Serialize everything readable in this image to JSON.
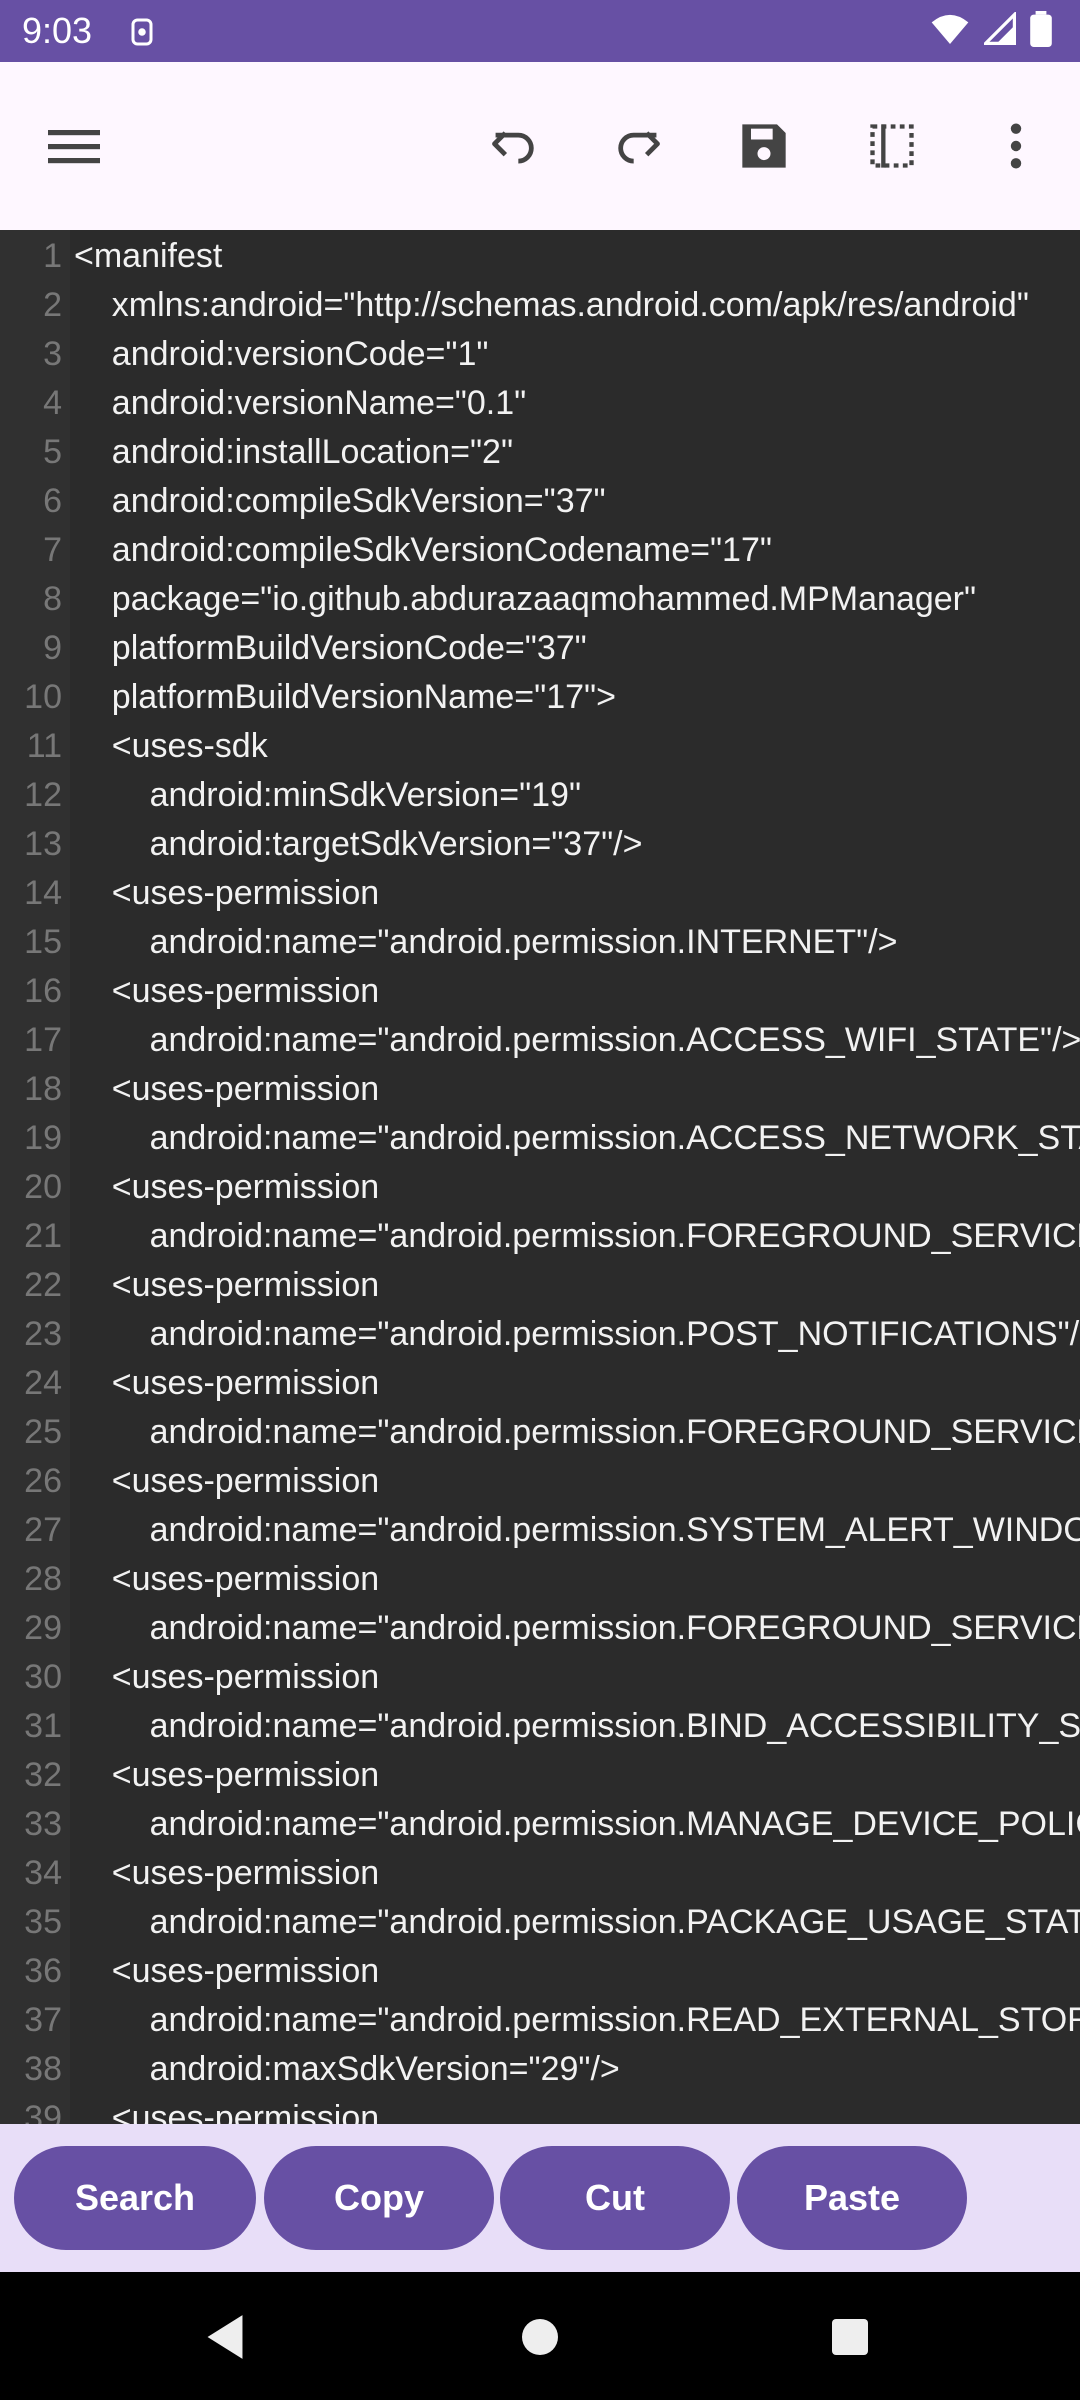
{
  "status": {
    "time": "9:03"
  },
  "toolbar": {
    "menu_icon": "menu-icon",
    "undo_icon": "undo-icon",
    "redo_icon": "redo-icon",
    "save_icon": "save-icon",
    "select_icon": "select-all-icon",
    "more_icon": "more-vert-icon"
  },
  "editor": {
    "lines": [
      {
        "n": "1",
        "text": "<manifest"
      },
      {
        "n": "2",
        "text": "    xmlns:android=\"http://schemas.android.com/apk/res/android\""
      },
      {
        "n": "3",
        "text": "    android:versionCode=\"1\""
      },
      {
        "n": "4",
        "text": "    android:versionName=\"0.1\""
      },
      {
        "n": "5",
        "text": "    android:installLocation=\"2\""
      },
      {
        "n": "6",
        "text": "    android:compileSdkVersion=\"37\""
      },
      {
        "n": "7",
        "text": "    android:compileSdkVersionCodename=\"17\""
      },
      {
        "n": "8",
        "text": "    package=\"io.github.abdurazaaqmohammed.MPManager\""
      },
      {
        "n": "9",
        "text": "    platformBuildVersionCode=\"37\""
      },
      {
        "n": "10",
        "text": "    platformBuildVersionName=\"17\">"
      },
      {
        "n": "11",
        "text": "    <uses-sdk"
      },
      {
        "n": "12",
        "text": "        android:minSdkVersion=\"19\""
      },
      {
        "n": "13",
        "text": "        android:targetSdkVersion=\"37\"/>"
      },
      {
        "n": "14",
        "text": "    <uses-permission"
      },
      {
        "n": "15",
        "text": "        android:name=\"android.permission.INTERNET\"/>"
      },
      {
        "n": "16",
        "text": "    <uses-permission"
      },
      {
        "n": "17",
        "text": "        android:name=\"android.permission.ACCESS_WIFI_STATE\"/>"
      },
      {
        "n": "18",
        "text": "    <uses-permission"
      },
      {
        "n": "19",
        "text": "        android:name=\"android.permission.ACCESS_NETWORK_STATE\"/>"
      },
      {
        "n": "20",
        "text": "    <uses-permission"
      },
      {
        "n": "21",
        "text": "        android:name=\"android.permission.FOREGROUND_SERVICE\"/>"
      },
      {
        "n": "22",
        "text": "    <uses-permission"
      },
      {
        "n": "23",
        "text": "        android:name=\"android.permission.POST_NOTIFICATIONS\"/>"
      },
      {
        "n": "24",
        "text": "    <uses-permission"
      },
      {
        "n": "25",
        "text": "        android:name=\"android.permission.FOREGROUND_SERVICE_SPECIAL_USE\"/>"
      },
      {
        "n": "26",
        "text": "    <uses-permission"
      },
      {
        "n": "27",
        "text": "        android:name=\"android.permission.SYSTEM_ALERT_WINDOW\"/>"
      },
      {
        "n": "28",
        "text": "    <uses-permission"
      },
      {
        "n": "29",
        "text": "        android:name=\"android.permission.FOREGROUND_SERVICE_DATA_SYNC\"/>"
      },
      {
        "n": "30",
        "text": "    <uses-permission"
      },
      {
        "n": "31",
        "text": "        android:name=\"android.permission.BIND_ACCESSIBILITY_SERVICE\"/>"
      },
      {
        "n": "32",
        "text": "    <uses-permission"
      },
      {
        "n": "33",
        "text": "        android:name=\"android.permission.MANAGE_DEVICE_POLICY_ACCESS\"/>"
      },
      {
        "n": "34",
        "text": "    <uses-permission"
      },
      {
        "n": "35",
        "text": "        android:name=\"android.permission.PACKAGE_USAGE_STATS\"/>"
      },
      {
        "n": "36",
        "text": "    <uses-permission"
      },
      {
        "n": "37",
        "text": "        android:name=\"android.permission.READ_EXTERNAL_STORAGE\""
      },
      {
        "n": "38",
        "text": "        android:maxSdkVersion=\"29\"/>"
      },
      {
        "n": "39",
        "text": "    <uses-permission"
      }
    ]
  },
  "actions": {
    "search": "Search",
    "copy": "Copy",
    "cut": "Cut",
    "paste": "Paste"
  },
  "colors": {
    "accent": "#6750a4",
    "toolbar_bg": "#fef7ff",
    "editor_bg": "#2b2b2b",
    "action_bar_bg": "#e8def8"
  }
}
